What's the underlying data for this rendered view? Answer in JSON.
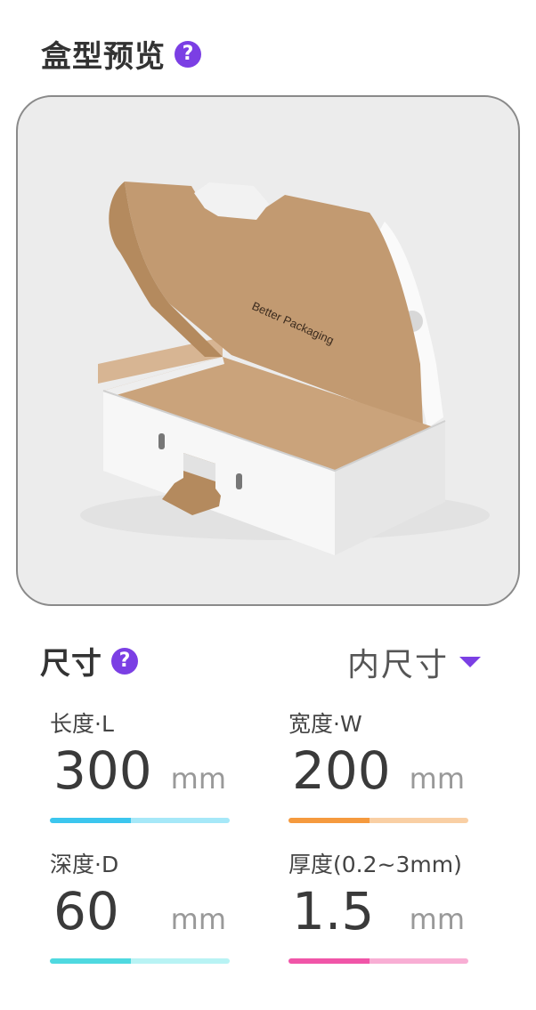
{
  "preview": {
    "title": "盒型预览",
    "help_icon": "?",
    "box_print_text": "Better Packaging"
  },
  "size": {
    "title": "尺寸",
    "help_icon": "?",
    "dimension_mode": "内尺寸",
    "fields": [
      {
        "label": "长度·L",
        "value": "300",
        "unit": "mm",
        "color": "#3cc6ee",
        "light_color": "#a6e8f8",
        "fill": 0.45
      },
      {
        "label": "宽度·W",
        "value": "200",
        "unit": "mm",
        "color": "#f59a3e",
        "light_color": "#f9cfa4",
        "fill": 0.45
      },
      {
        "label": "深度·D",
        "value": "60",
        "unit": "mm",
        "color": "#4fd9e0",
        "light_color": "#b8f3f4",
        "fill": 0.45
      },
      {
        "label": "厚度(0.2~3mm)",
        "value": "1.5",
        "unit": "mm",
        "color": "#f055a8",
        "light_color": "#f8aed4",
        "fill": 0.45
      }
    ]
  },
  "colors": {
    "accent": "#7b3fe4",
    "kraft": "#b48a5e",
    "panel_bg": "#ececec"
  }
}
